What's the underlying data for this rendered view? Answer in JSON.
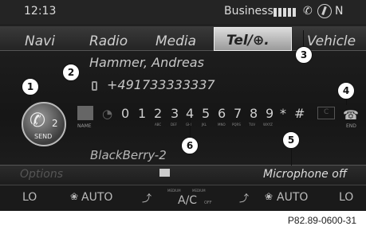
{
  "status_bar": {
    "clock": "12:13",
    "carrier": "Business",
    "phone_icon": "phone-icon",
    "compass_icon": "compass-icon",
    "north": "N"
  },
  "main_menu": {
    "items": [
      {
        "label": "Navi"
      },
      {
        "label": "Radio"
      },
      {
        "label": "Media"
      },
      {
        "label": "Tel/⊕."
      },
      {
        "label": "Vehicle"
      }
    ]
  },
  "contact": {
    "name": "Hammer, Andreas",
    "number": "+491733333337",
    "number_type_icon": "phone-type-icon"
  },
  "send_button": {
    "label": "SEND",
    "count": "2"
  },
  "dial_pad": {
    "name_label": "NAME",
    "keys": [
      {
        "digit": "0",
        "sub": ""
      },
      {
        "digit": "1",
        "sub": ""
      },
      {
        "digit": "2",
        "sub": "ABC"
      },
      {
        "digit": "3",
        "sub": "DEF"
      },
      {
        "digit": "4",
        "sub": "GHI"
      },
      {
        "digit": "5",
        "sub": "JKL"
      },
      {
        "digit": "6",
        "sub": "MNO"
      },
      {
        "digit": "7",
        "sub": "PQRS"
      },
      {
        "digit": "8",
        "sub": "TUV"
      },
      {
        "digit": "9",
        "sub": "WXYZ"
      },
      {
        "digit": "*",
        "sub": ""
      },
      {
        "digit": "#",
        "sub": ""
      }
    ],
    "c_key": "C",
    "end_label": "END"
  },
  "device_name": "BlackBerry-2",
  "options_bar": {
    "options": "Options",
    "mic_status": "Microphone off"
  },
  "climate_bar": {
    "left_temp": "LO",
    "left_auto": "AUTO",
    "ac_mini_left": "MEDIUM",
    "ac_mini_right": "MEDIUM",
    "ac_label": "A/C",
    "ac_off": "OFF",
    "right_auto": "AUTO",
    "right_temp": "LO"
  },
  "callouts": [
    "1",
    "2",
    "3",
    "4",
    "5",
    "6"
  ],
  "caption": "P82.89-0600-31"
}
